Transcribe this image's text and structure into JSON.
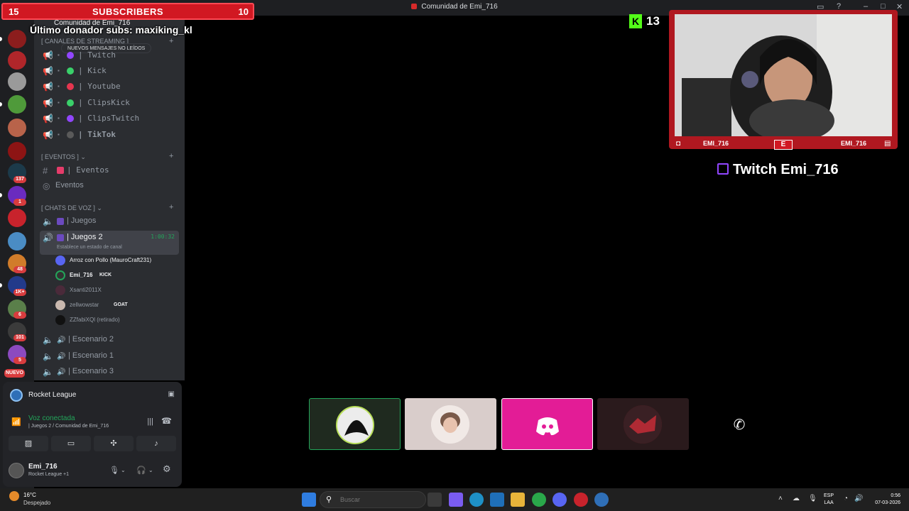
{
  "window": {
    "title": "Comunidad de Emi_716"
  },
  "overlay": {
    "subs_left": "15",
    "subs_label": "SUBSCRIBERS",
    "subs_right": "10",
    "donor_text": "Último donador subs: maxiking_kl",
    "kick_count": "13",
    "cam_left_name": "EMI_716",
    "cam_right_name": "EMI_716",
    "twitch_text": "Twitch Emi_716"
  },
  "server": {
    "name": "Comunidad de Emi_716",
    "new_messages": "NUEVOS MENSAJES NO LEÍDOS"
  },
  "categories": {
    "streaming": "[ CANALES DE STREAMING ]",
    "events": "[ EVENTOS ] ⌄",
    "voice": "[ CHATS DE VOZ ] ⌄"
  },
  "streaming_channels": [
    {
      "label": "| Twitch",
      "color": "#9146ff"
    },
    {
      "label": "| Kick",
      "color": "#3ad06a"
    },
    {
      "label": "| Youtube",
      "color": "#e5364f"
    },
    {
      "label": "| ClipsKick",
      "color": "#3ad06a"
    },
    {
      "label": "| ClipsTwitch",
      "color": "#9146ff"
    },
    {
      "label": "| TikTok",
      "color": "#5a5a5a"
    }
  ],
  "event_channels": [
    {
      "label": "| Eventos"
    },
    {
      "label": "Eventos"
    }
  ],
  "voice_channels": {
    "juegos": "| Juegos",
    "juegos2": "| Juegos 2",
    "juegos2_timer": "1:00:32",
    "juegos2_status": "Establece un estado de canal",
    "escenario2": "| Escenario 2",
    "escenario1": "| Escenario 1",
    "escenario3": "| Escenario 3"
  },
  "voice_users": [
    {
      "name": "Arroz con Pollo (MauroCraft231)",
      "tag": ""
    },
    {
      "name": "Emi_716",
      "tag": "KICK"
    },
    {
      "name": "Xsanti2011X",
      "tag": ""
    },
    {
      "name": "zellwowstar",
      "tag": "GOAT"
    },
    {
      "name": "ZZfabiXQl (retirado)",
      "tag": ""
    }
  ],
  "rail_badges": [
    "137",
    "1",
    "48",
    "1K+",
    "6",
    "101",
    "5",
    "NUEVO"
  ],
  "panel": {
    "game": "Rocket League",
    "voice_status": "Voz conectada",
    "voice_location": "| Juegos 2 / Comunidad de Emi_716",
    "username": "Emi_716",
    "user_status": "Rocket League +1"
  },
  "taskbar": {
    "temp": "16°C",
    "condition": "Despejado",
    "search_placeholder": "Buscar",
    "lang1": "ESP",
    "lang2": "LAA",
    "time": "0:56",
    "date": "07-03-2026"
  },
  "colors": {
    "accent_red": "#d11822",
    "discord_pink": "#e31c96",
    "voice_green": "#23a55a",
    "kick_green": "#53fc18",
    "twitch_purple": "#9146ff"
  }
}
